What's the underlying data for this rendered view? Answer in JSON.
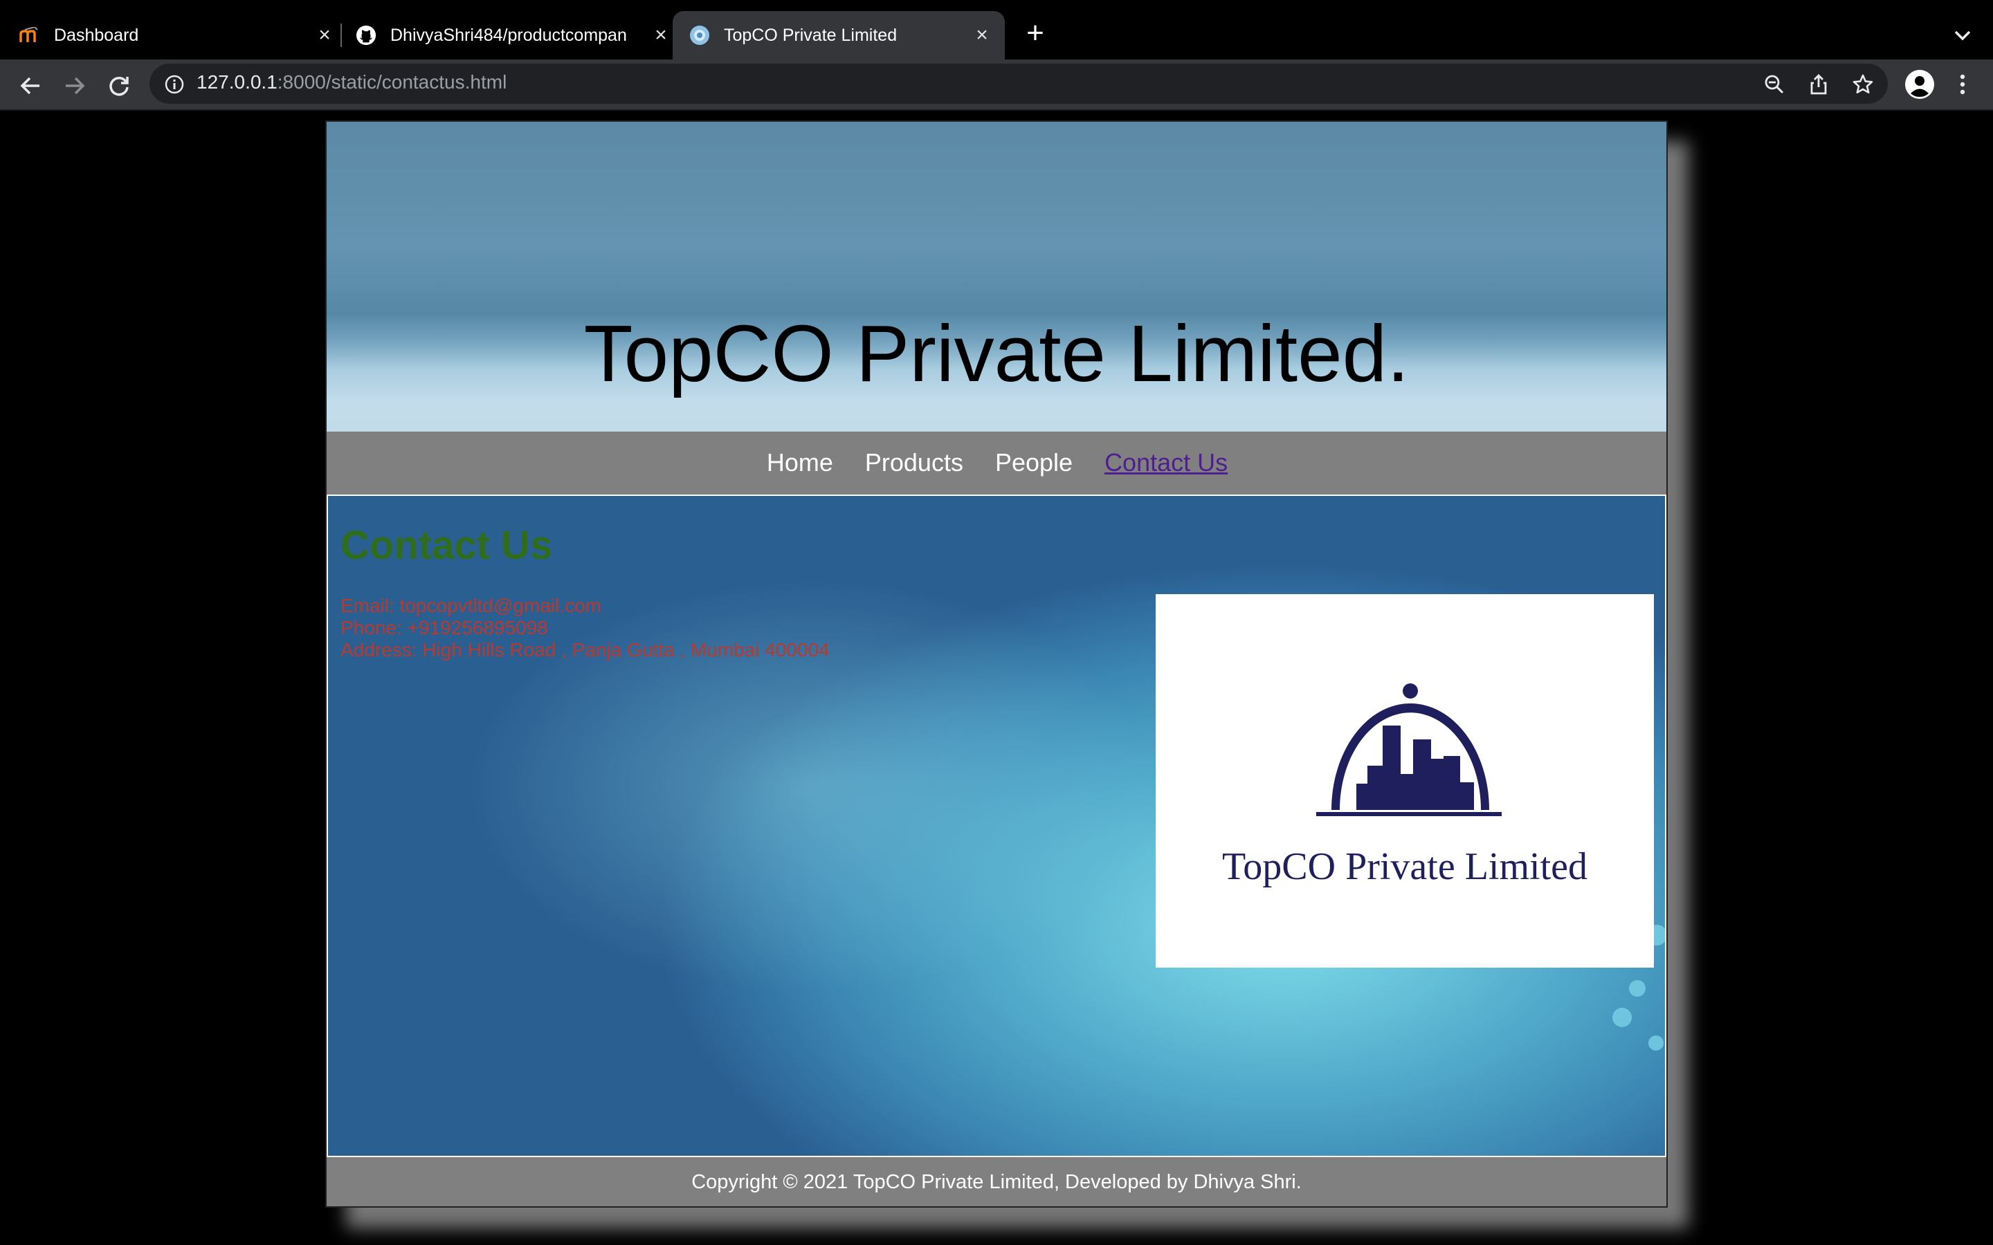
{
  "browser": {
    "tabs": [
      {
        "title": "Dashboard",
        "favicon": "moodle-icon",
        "active": false
      },
      {
        "title": "DhivyaShri484/productcompan",
        "favicon": "github-icon",
        "active": false
      },
      {
        "title": "TopCO Private Limited",
        "favicon": "site-globe-icon",
        "active": true
      }
    ],
    "url_host": "127.0.0.1",
    "url_rest": ":8000/static/contactus.html"
  },
  "site": {
    "title": "TopCO Private Limited.",
    "nav": [
      "Home",
      "Products",
      "People",
      "Contact Us"
    ],
    "current_nav": "Contact Us",
    "contact": {
      "heading": "Contact Us",
      "email": "Email: topcopvtltd@gmail.com",
      "phone": "Phone: +919256895098",
      "address": "Address: High Hills Road , Panja Gutta , Mumbai 400004"
    },
    "logo_text": "TopCO Private Limited",
    "footer": "Copyright © 2021 TopCO Private Limited, Developed by Dhivya Shri."
  },
  "colors": {
    "nav_link": "#ffffff",
    "nav_current": "#4d1f8f",
    "contact_heading": "#2f6d1d",
    "contact_text": "#b83a2e",
    "logo_navy": "#1f1f5e"
  }
}
